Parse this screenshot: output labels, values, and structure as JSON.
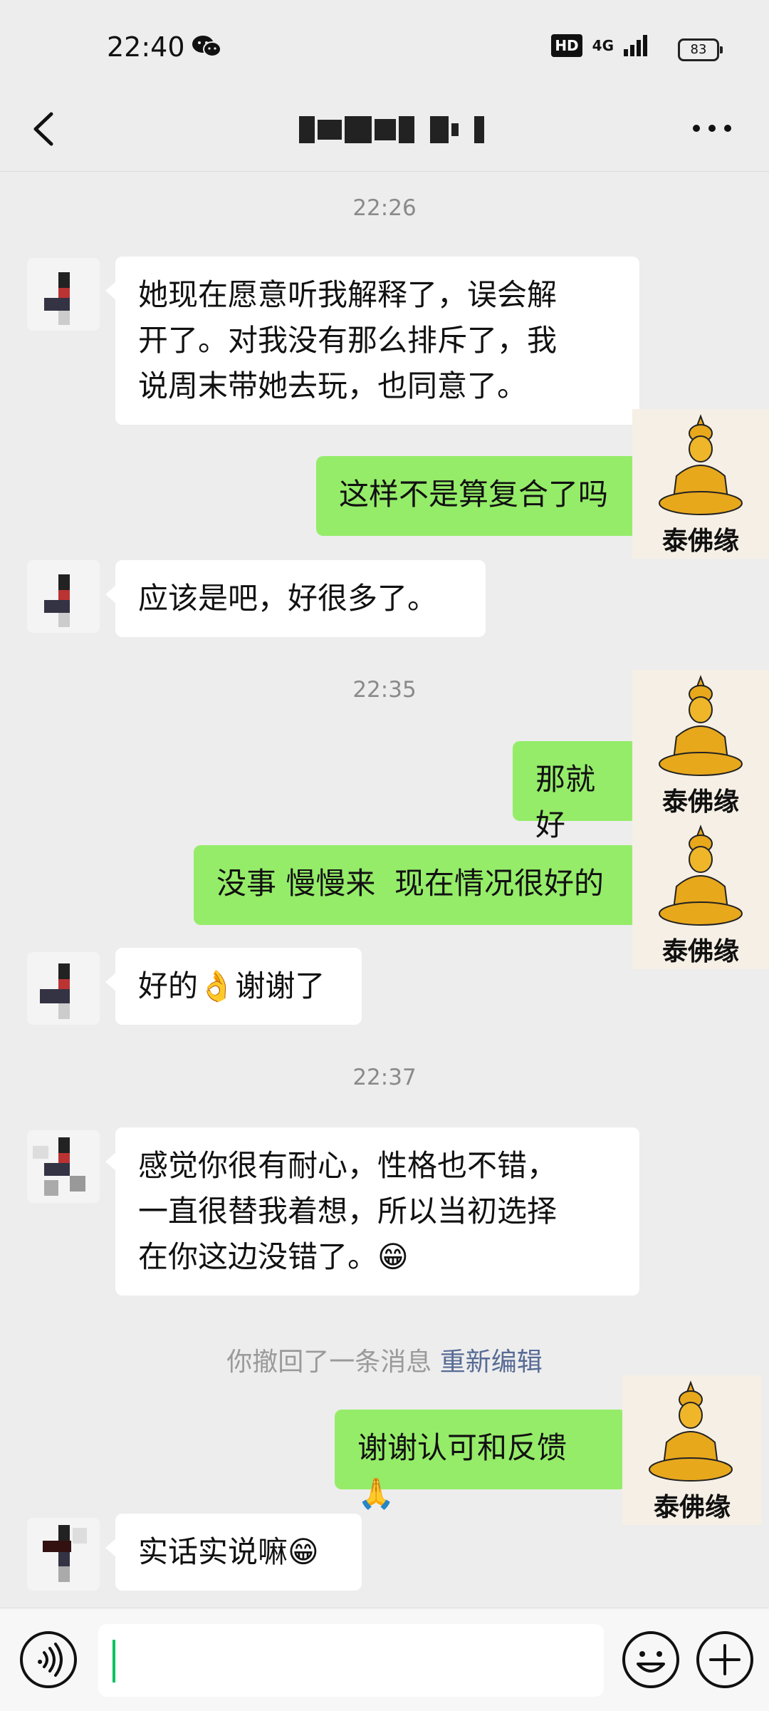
{
  "status_bar": {
    "time": "22:40",
    "hd": "HD",
    "network": "4G",
    "battery": "83"
  },
  "header": {
    "back_icon": "chevron-left-icon",
    "more_icon": "more-dots-icon"
  },
  "messages": {
    "ts1": "22:26",
    "m1": "她现在愿意听我解释了，误会解\n开了。对我没有那么排斥了，我\n说周末带她去玩，也同意了。",
    "m2": "这样不是算复合了吗",
    "m3": "应该是吧，好很多了。",
    "ts2": "22:35",
    "m4": "那就好",
    "m5": "没事 慢慢来  现在情况很好的",
    "m6_a": "好的",
    "m6_emoji": "👌",
    "m6_b": "谢谢了",
    "ts3": "22:37",
    "m7": "感觉你很有耐心，性格也不错，\n一直很替我着想，所以当初选择\n在你这边没错了。",
    "m7_emoji": "😁",
    "recall": "你撤回了一条消息",
    "recall_edit": "重新编辑",
    "m8": "谢谢认可和反馈",
    "m8_emoji": "🙏",
    "m9": "实话实说嘛",
    "m9_emoji": "😁"
  },
  "self_avatar": {
    "label": "泰佛缘"
  },
  "input_bar": {
    "value": "",
    "voice_icon": "voice-icon",
    "emoji_icon": "emoji-icon",
    "plus_icon": "plus-icon"
  },
  "colors": {
    "background": "#ededed",
    "bubble_in": "#ffffff",
    "bubble_out": "#95ec69",
    "link": "#576b95",
    "avatar_bg": "#f5efe5",
    "buddha_gold": "#e8a81c"
  }
}
